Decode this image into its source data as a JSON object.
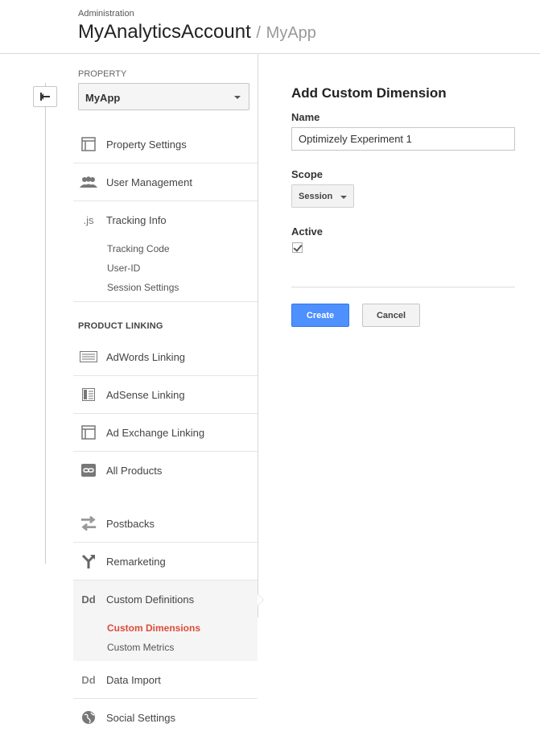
{
  "header": {
    "breadcrumb": "Administration",
    "account": "MyAnalyticsAccount",
    "separator": "/",
    "property": "MyApp"
  },
  "sidebar": {
    "property_label": "PROPERTY",
    "property_value": "MyApp",
    "items": [
      {
        "label": "Property Settings",
        "icon": "property-settings-icon"
      },
      {
        "label": "User Management",
        "icon": "users-icon"
      },
      {
        "label": "Tracking Info",
        "icon": "js-icon"
      },
      {
        "label": "AdWords Linking",
        "icon": "adwords-icon"
      },
      {
        "label": "AdSense Linking",
        "icon": "adsense-icon"
      },
      {
        "label": "Ad Exchange Linking",
        "icon": "ad-exchange-icon"
      },
      {
        "label": "All Products",
        "icon": "link-icon"
      },
      {
        "label": "Postbacks",
        "icon": "postbacks-icon"
      },
      {
        "label": "Remarketing",
        "icon": "remarketing-icon"
      },
      {
        "label": "Custom Definitions",
        "icon": "dd-icon"
      },
      {
        "label": "Data Import",
        "icon": "dd-icon"
      },
      {
        "label": "Social Settings",
        "icon": "globe-icon"
      }
    ],
    "tracking_sub": [
      "Tracking Code",
      "User-ID",
      "Session Settings"
    ],
    "section_product_linking": "PRODUCT LINKING",
    "custom_sub": [
      "Custom Dimensions",
      "Custom Metrics"
    ],
    "dd_glyph": "Dd",
    "js_glyph": ".js"
  },
  "form": {
    "title": "Add Custom Dimension",
    "name_label": "Name",
    "name_value": "Optimizely Experiment 1",
    "scope_label": "Scope",
    "scope_value": "Session",
    "active_label": "Active",
    "active_checked": true,
    "create_label": "Create",
    "cancel_label": "Cancel"
  },
  "colors": {
    "accent_blue": "#4d90fe",
    "active_red": "#dd4b39"
  }
}
